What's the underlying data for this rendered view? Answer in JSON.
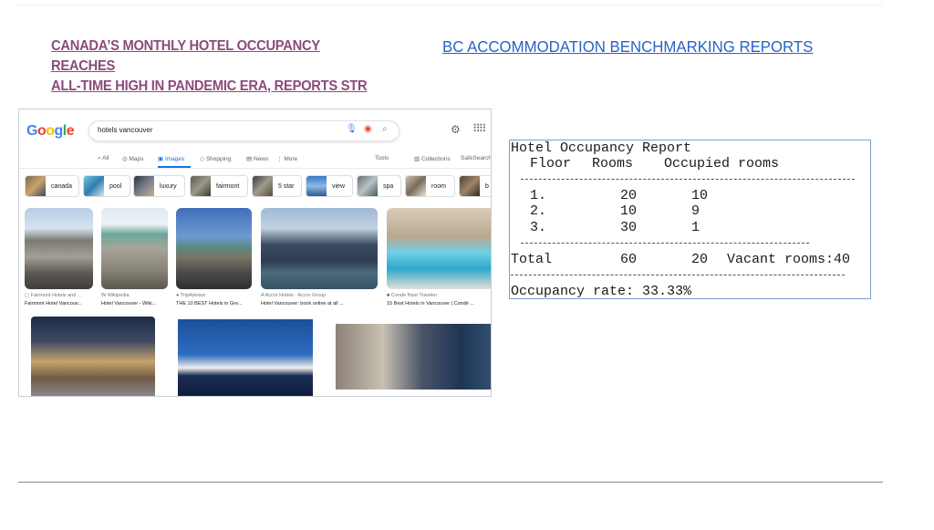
{
  "headline": {
    "line1": "CANADA’S MONTHLY HOTEL OCCUPANCY REACHES",
    "line2": "ALL-TIME HIGH IN PANDEMIC ERA, REPORTS STR"
  },
  "bc_link": "BC ACCOMMODATION BENCHMARKING REPORTS",
  "colors": {
    "headline": "#8c4a7d",
    "link": "#2a62c5",
    "google_active": "#1a73e8"
  },
  "google": {
    "logo": [
      "G",
      "o",
      "o",
      "g",
      "l",
      "e"
    ],
    "query": "hotels vancouver",
    "icons": {
      "mic": "mic-icon",
      "camera": "camera-icon",
      "search": "search-icon",
      "settings": "gear-icon",
      "apps": "apps-grid-icon"
    },
    "tabs": [
      "All",
      "Maps",
      "Images",
      "Shopping",
      "News",
      "More",
      "Tools",
      "Collections",
      "SafeSearch"
    ],
    "active_tab": "Images",
    "chips": [
      "canada",
      "pool",
      "luxury",
      "fairmont",
      "5 star",
      "view",
      "spa",
      "room",
      "b"
    ],
    "results_row1": [
      {
        "source": "Fairmont Hotels and ...",
        "title": "Fairmont Hotel Vancouv..."
      },
      {
        "source": "Wikipedia",
        "title": "Hotel Vancouver - Wiki..."
      },
      {
        "source": "TripAdvisor",
        "title": "THE 10 BEST Hotels in Gre..."
      },
      {
        "source": "Accor Hotels · Accor Group",
        "title": "Hotel Vancouver: book online at all ..."
      },
      {
        "source": "Conde Nast Traveler",
        "title": "15 Best Hotels in Vancouver | Condé ..."
      }
    ]
  },
  "report": {
    "title": "Hotel Occupancy Report",
    "headers": {
      "floor": "Floor",
      "rooms": "Rooms",
      "occupied": "Occupied rooms"
    },
    "rows": [
      {
        "floor": "1.",
        "rooms": "20",
        "occupied": "10"
      },
      {
        "floor": "2.",
        "rooms": "10",
        "occupied": "9"
      },
      {
        "floor": "3.",
        "rooms": "30",
        "occupied": "1"
      }
    ],
    "total": {
      "label": "Total",
      "rooms": "60",
      "occupied": "20",
      "vacant": "Vacant rooms:40"
    },
    "rate": "Occupancy rate: 33.33%"
  }
}
